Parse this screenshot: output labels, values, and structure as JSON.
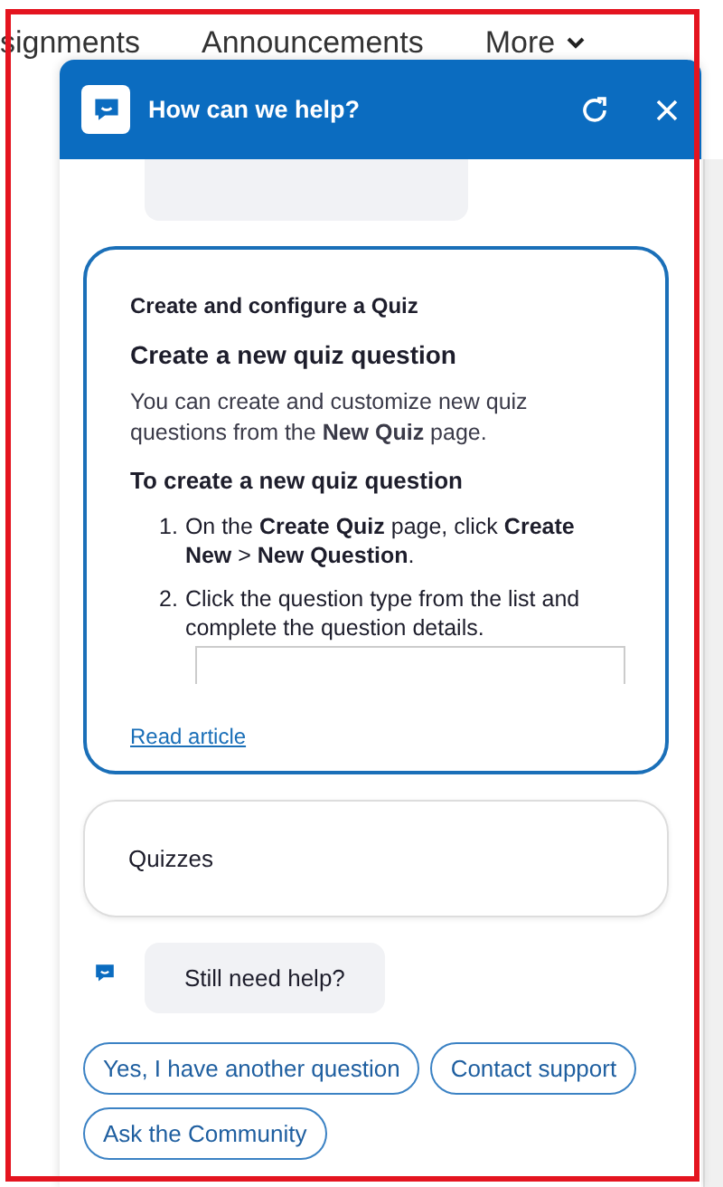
{
  "background_nav": {
    "items": [
      "signments",
      "Announcements"
    ],
    "more": "More"
  },
  "chat": {
    "title": "How can we help?",
    "messages": [
      {
        "kind": "article",
        "category": "Create and configure a Quiz",
        "heading": "Create a new quiz question",
        "paragraph": "You can create and customize new quiz questions from the **New Quiz** page.",
        "subheading": "To create a new quiz question",
        "steps": [
          {
            "number": "1.",
            "text": "On the **Create Quiz** page, click **Create New** > **New Question**."
          },
          {
            "number": "2.",
            "text": "Click the question type from the list and complete the question details."
          }
        ],
        "link": "Read article"
      },
      {
        "kind": "card",
        "text": "Quizzes"
      },
      {
        "kind": "bot_text",
        "text": "Still need help?"
      }
    ],
    "quick_replies": [
      "Yes, I have another question",
      "Contact support",
      "Ask the Community"
    ]
  }
}
